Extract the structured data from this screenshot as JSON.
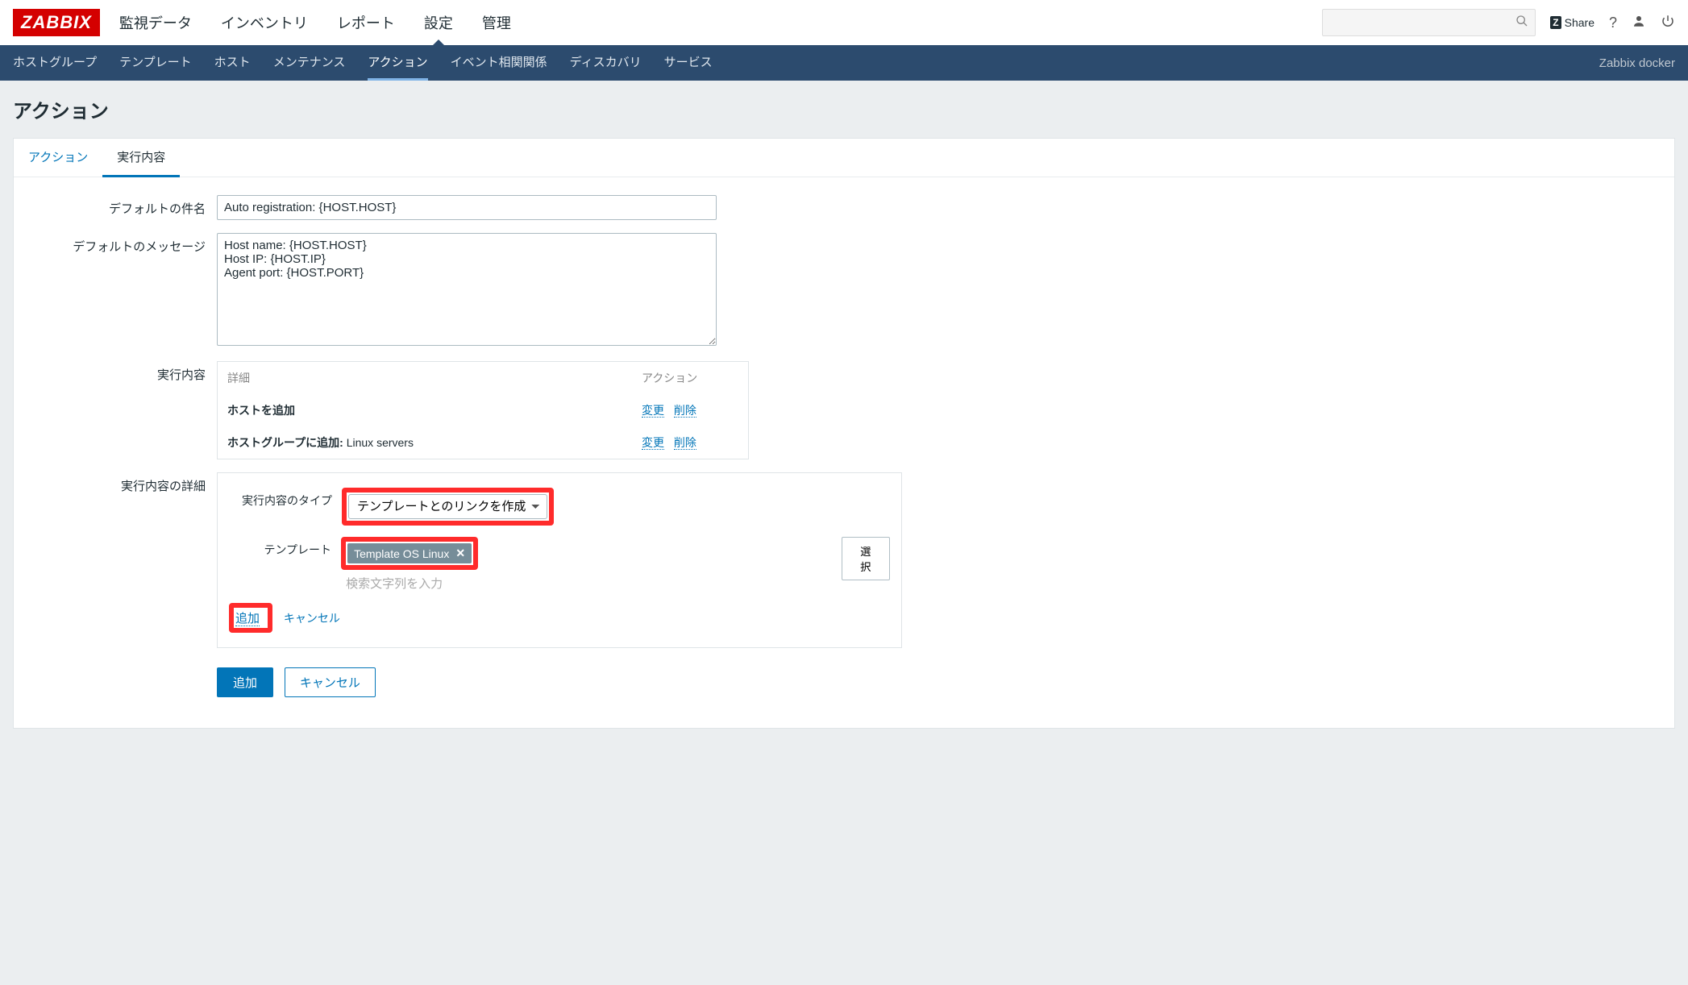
{
  "top": {
    "logo": "ZABBIX",
    "nav": [
      "監視データ",
      "インベントリ",
      "レポート",
      "設定",
      "管理"
    ],
    "nav_active_index": 3,
    "search_placeholder": "",
    "share": "Share",
    "help": "?",
    "user": "👤",
    "power": "⏻"
  },
  "subnav": {
    "items": [
      "ホストグループ",
      "テンプレート",
      "ホスト",
      "メンテナンス",
      "アクション",
      "イベント相関関係",
      "ディスカバリ",
      "サービス"
    ],
    "active_index": 4,
    "right": "Zabbix docker"
  },
  "page_title": "アクション",
  "tabs": {
    "tab1": "アクション",
    "tab2": "実行内容"
  },
  "form": {
    "subject_label": "デフォルトの件名",
    "subject_value": "Auto registration: {HOST.HOST}",
    "message_label": "デフォルトのメッセージ",
    "message_value": "Host name: {HOST.HOST}\nHost IP: {HOST.IP}\nAgent port: {HOST.PORT}",
    "ops_label": "実行内容",
    "ops_header_detail": "詳細",
    "ops_header_action": "アクション",
    "ops": [
      {
        "name": "ホストを追加",
        "detail": ""
      },
      {
        "name": "ホストグループに追加:",
        "detail": " Linux servers"
      }
    ],
    "op_change": "変更",
    "op_delete": "削除",
    "details_label": "実行内容の詳細",
    "type_label": "実行内容のタイプ",
    "type_value": "テンプレートとのリンクを作成",
    "template_label": "テンプレート",
    "template_tag": "Template OS Linux",
    "template_hint": "検索文字列を入力",
    "select_btn": "選択",
    "inline_add": "追加",
    "inline_cancel": "キャンセル",
    "btn_add": "追加",
    "btn_cancel": "キャンセル"
  }
}
